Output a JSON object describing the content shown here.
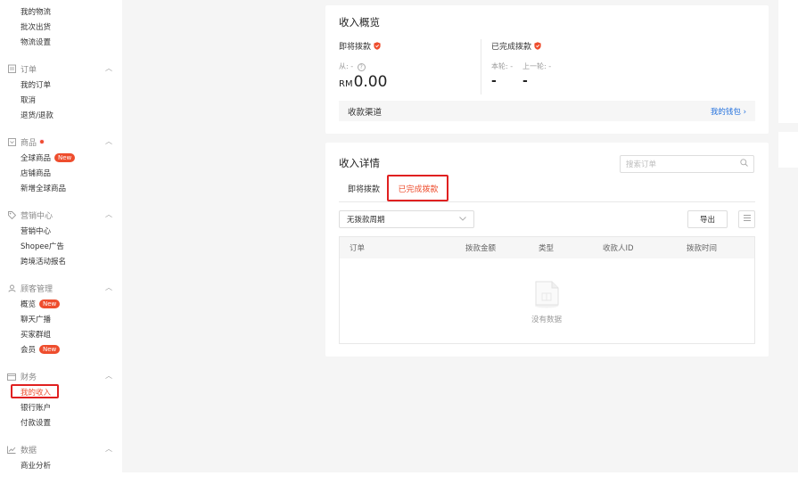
{
  "sidebar": {
    "logistics": {
      "items": [
        "我的物流",
        "批次出货",
        "物流设置"
      ]
    },
    "orders": {
      "title": "订单",
      "icon": "clipboard-icon",
      "items": [
        "我的订单",
        "取消",
        "退货/退款"
      ]
    },
    "products": {
      "title": "商品",
      "icon": "box-icon",
      "items": [
        {
          "label": "全球商品",
          "badge": "New"
        },
        {
          "label": "店铺商品",
          "badge": ""
        },
        {
          "label": "新增全球商品",
          "badge": ""
        }
      ]
    },
    "marketing": {
      "title": "营销中心",
      "icon": "tag-icon",
      "items": [
        "营销中心",
        "Shopee广告",
        "跨境活动报名"
      ]
    },
    "customers": {
      "title": "顾客管理",
      "icon": "user-icon",
      "items": [
        {
          "label": "概览",
          "badge": "New"
        },
        {
          "label": "聊天广播",
          "badge": ""
        },
        {
          "label": "买家群组",
          "badge": ""
        },
        {
          "label": "会员",
          "badge": "New"
        }
      ]
    },
    "finance": {
      "title": "财务",
      "icon": "wallet-icon",
      "items": [
        "我的收入",
        "银行账户",
        "付款设置"
      ]
    },
    "data": {
      "title": "数据",
      "icon": "chart-icon",
      "items": [
        "商业分析"
      ]
    }
  },
  "overview": {
    "title": "收入概览",
    "pending": {
      "label": "即将拨款",
      "from": "从: -",
      "currency": "RM",
      "amount": "0.00"
    },
    "completed": {
      "label": "已完成拨款",
      "this_round": "本轮: -",
      "last_round": "上一轮: -",
      "this_value": "-",
      "last_value": "-"
    },
    "channel": {
      "label": "收款渠道",
      "link": "我的钱包 ›"
    }
  },
  "details": {
    "title": "收入详情",
    "search_placeholder": "搜索订单",
    "tabs": [
      "即将拨款",
      "已完成拨款"
    ],
    "active_tab": "已完成拨款",
    "filter_value": "无拨款周期",
    "export_label": "导出",
    "columns": [
      "订单",
      "拨款金额",
      "类型",
      "收款人ID",
      "拨款时间"
    ],
    "empty_text": "没有数据"
  },
  "colors": {
    "accent": "#ee4d2d",
    "link": "#2673dd",
    "highlight": "#e02020"
  }
}
